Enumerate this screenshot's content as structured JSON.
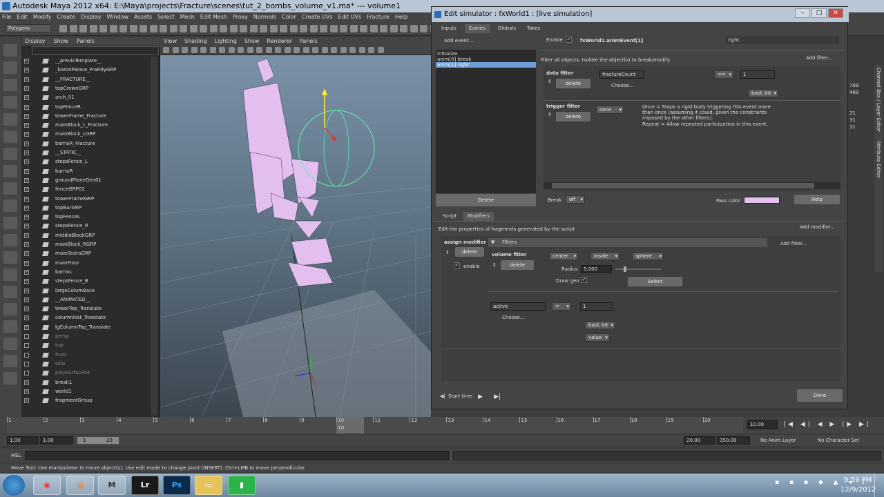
{
  "window": {
    "title": "Autodesk Maya 2012 x64: E:\\Maya\\projects\\Fracture\\scenes\\tut_2_bombs_volume_v1.ma*   ---   volume1"
  },
  "menubar": [
    "File",
    "Edit",
    "Modify",
    "Create",
    "Display",
    "Window",
    "Assets",
    "Select",
    "Mesh",
    "Edit Mesh",
    "Proxy",
    "Normals",
    "Color",
    "Create UVs",
    "Edit UVs",
    "Fracture",
    "Help"
  ],
  "shelf_mode": "Polygons",
  "outliner": {
    "menu": [
      "Display",
      "Show",
      "Panels"
    ],
    "items": [
      {
        "label": "__previsTemplate__",
        "dim": false
      },
      {
        "label": "_baronPalace_FraRdyGRP",
        "dim": false
      },
      {
        "label": "__FRACTURE__",
        "dim": false
      },
      {
        "label": "topCrownGRP",
        "dim": false
      },
      {
        "label": "arch_01",
        "dim": false
      },
      {
        "label": "topFenceR",
        "dim": false
      },
      {
        "label": "towerFrame_Fracture",
        "dim": false
      },
      {
        "label": "mainBlock_L_Fracture",
        "dim": false
      },
      {
        "label": "mainBlock_LGRP",
        "dim": false
      },
      {
        "label": "barrioR_Fracture",
        "dim": false
      },
      {
        "label": "__STATIC__",
        "dim": false
      },
      {
        "label": "stepsFence_L",
        "dim": false
      },
      {
        "label": "barrioR",
        "dim": false
      },
      {
        "label": "groundPlaneGeo01",
        "dim": false
      },
      {
        "label": "fenceGRP02",
        "dim": false
      },
      {
        "label": "towerFrameGRP",
        "dim": false
      },
      {
        "label": "topBarGRP",
        "dim": false
      },
      {
        "label": "topFenceL",
        "dim": false
      },
      {
        "label": "stepsFence_R",
        "dim": false
      },
      {
        "label": "middleBlockGRP",
        "dim": false
      },
      {
        "label": "mainBlock_RGRP",
        "dim": false
      },
      {
        "label": "mainStairsGRP",
        "dim": false
      },
      {
        "label": "mainFloor",
        "dim": false
      },
      {
        "label": "barrioL",
        "dim": false
      },
      {
        "label": "stepsFence_B",
        "dim": false
      },
      {
        "label": "largeColumBace",
        "dim": false
      },
      {
        "label": "__ANIMATED__",
        "dim": false
      },
      {
        "label": "towerTop_Translate",
        "dim": false
      },
      {
        "label": "columnHat_Translate",
        "dim": false
      },
      {
        "label": "lgColumnTop_Translate",
        "dim": false
      },
      {
        "label": "persp",
        "dim": true
      },
      {
        "label": "top",
        "dim": true
      },
      {
        "label": "front",
        "dim": true
      },
      {
        "label": "side",
        "dim": true
      },
      {
        "label": "polySurface54",
        "dim": true
      },
      {
        "label": "break1",
        "dim": false
      },
      {
        "label": "world1",
        "dim": false
      },
      {
        "label": "fragmentGroup",
        "dim": false
      }
    ]
  },
  "viewport": {
    "menu": [
      "View",
      "Shading",
      "Lighting",
      "Show",
      "Renderer",
      "Panels"
    ]
  },
  "dialog": {
    "title": "Edit simulator : fxWorld1 : [live simulation]",
    "tabs": [
      "Inputs",
      "Events",
      "Globals",
      "Takes"
    ],
    "add_event": "Add event...",
    "events": [
      "initialize",
      "anim[0] break",
      "anim[1] right"
    ],
    "enable_label": "Enable",
    "event_name": "fxWorld1.animEvent[1]",
    "event_field": "right",
    "filter_desc": "Filter all objects.  Isolate the object(s) to break/modify.",
    "add_filter": "Add filter...",
    "data_filter": {
      "title": "data filter",
      "delete": "delete",
      "attr": "fractureCount",
      "choose": "Choose...",
      "op": "==",
      "value": "1",
      "type": "bool, int"
    },
    "trigger_filter": {
      "title": "trigger filter",
      "delete": "delete",
      "mode": "once",
      "help1": "Once = Stops a rigid body triggering this event more",
      "help2": "than once (assuming it could, given the constraints",
      "help3": "imposed by the other filters).",
      "help4": "Repeat = Allow repeated participation in this event."
    },
    "delete_btn": "Delete",
    "break_label": "Break",
    "break_value": "off",
    "pass_color_label": "Pass color",
    "pass_color": "#e6c3f0",
    "help_btn": "Help",
    "subtabs": [
      "Script",
      "Modifiers"
    ],
    "modifiers_desc": "Edit the properties of fragments generated by the script",
    "add_modifier": "Add modifier...",
    "assign_modifier": {
      "title": "assign modifier",
      "delete": "delete",
      "enable": "enable",
      "filters": "Filters",
      "add_filter": "Add filter..."
    },
    "volume_filter": {
      "title": "volume filter",
      "delete": "delete",
      "center": "center",
      "inside": "inside",
      "shape": "sphere",
      "radius_label": "Radius",
      "radius": "5.000",
      "draw_geo": "Draw geo",
      "select": "Select"
    },
    "attr_row": {
      "attr": "active",
      "op": "=",
      "value": "1",
      "choose": "Choose...",
      "type": "bool, int",
      "value_dd": "value"
    },
    "start_time": "Start time",
    "done": "Done"
  },
  "channel_box": {
    "values": [
      "769",
      "469",
      "31",
      "31",
      "31"
    ],
    "tabs": [
      "Channel Box / Layer Editor",
      "Attribute Editor"
    ]
  },
  "timeline": {
    "ticks": [
      "1",
      "2",
      "3",
      "4",
      "5",
      "6",
      "7",
      "8",
      "9",
      "10",
      "11",
      "12",
      "13",
      "14",
      "15",
      "16",
      "17",
      "18",
      "19",
      "20"
    ],
    "current": "10",
    "current_field": "10.00"
  },
  "range": {
    "start": "1.00",
    "start2": "1.00",
    "inner_start": "1",
    "inner_end": "20",
    "end": "20.00",
    "end2": "350.00",
    "anim_layer": "No Anim Layer",
    "char_set": "No Character Set"
  },
  "command": {
    "label": "MEL"
  },
  "help": "Move Tool: Use manipulator to move object(s). Use edit mode to change pivot (INSERT).  Ctrl+LMB to move perpendicular.",
  "taskbar": {
    "time": "9:59 PM",
    "date": "12/9/2012"
  }
}
